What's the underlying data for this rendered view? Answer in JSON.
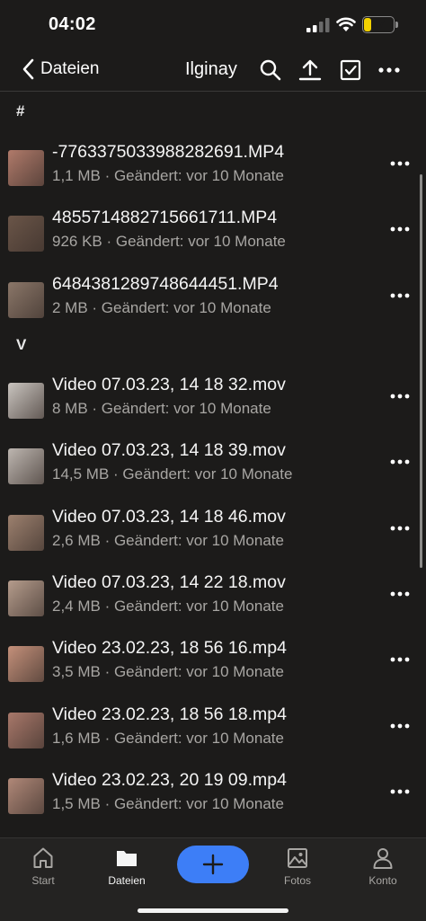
{
  "status_bar": {
    "time": "04:02",
    "battery_level": "17"
  },
  "nav": {
    "back_label": "Dateien",
    "title": "Ilginay"
  },
  "sections": [
    {
      "header": "#"
    },
    {
      "header": "V"
    }
  ],
  "files": [
    {
      "name": "-7763375033988282691.MP4",
      "meta": "1,1 MB · Geändert: vor 10 Monate",
      "thumb_color": "#b07a6a"
    },
    {
      "name": "4855714882715661711.MP4",
      "meta": "926 KB · Geändert: vor 10 Monate",
      "thumb_color": "#6a5548"
    },
    {
      "name": "6484381289748644451.MP4",
      "meta": "2 MB · Geändert: vor 10 Monate",
      "thumb_color": "#8a7668"
    },
    {
      "name": "Video 07.03.23, 14 18 32.mov",
      "meta": "8 MB · Geändert: vor 10 Monate",
      "thumb_color": "#c9c4bf"
    },
    {
      "name": "Video 07.03.23, 14 18 39.mov",
      "meta": "14,5 MB · Geändert: vor 10 Monate",
      "thumb_color": "#bdb6b0"
    },
    {
      "name": "Video 07.03.23, 14 18 46.mov",
      "meta": "2,6 MB · Geändert: vor 10 Monate",
      "thumb_color": "#9c806e"
    },
    {
      "name": "Video 07.03.23, 14 22 18.mov",
      "meta": "2,4 MB · Geändert: vor 10 Monate",
      "thumb_color": "#b59c8c"
    },
    {
      "name": "Video 23.02.23, 18 56 16.mp4",
      "meta": "3,5 MB · Geändert: vor 10 Monate",
      "thumb_color": "#c4907a"
    },
    {
      "name": "Video 23.02.23, 18 56 18.mp4",
      "meta": "1,6 MB · Geändert: vor 10 Monate",
      "thumb_color": "#a8786a"
    },
    {
      "name": "Video 23.02.23, 20 19 09.mp4",
      "meta": "1,5 MB · Geändert: vor 10 Monate",
      "thumb_color": "#b08878"
    }
  ],
  "tabs": [
    {
      "label": "Start",
      "icon": "home-icon"
    },
    {
      "label": "Dateien",
      "icon": "folder-icon"
    },
    {
      "label": "Fotos",
      "icon": "photos-icon"
    },
    {
      "label": "Konto",
      "icon": "person-icon"
    }
  ],
  "colors": {
    "accent": "#3d7ef7",
    "background": "#1c1b1a",
    "battery": "#f2d100"
  }
}
